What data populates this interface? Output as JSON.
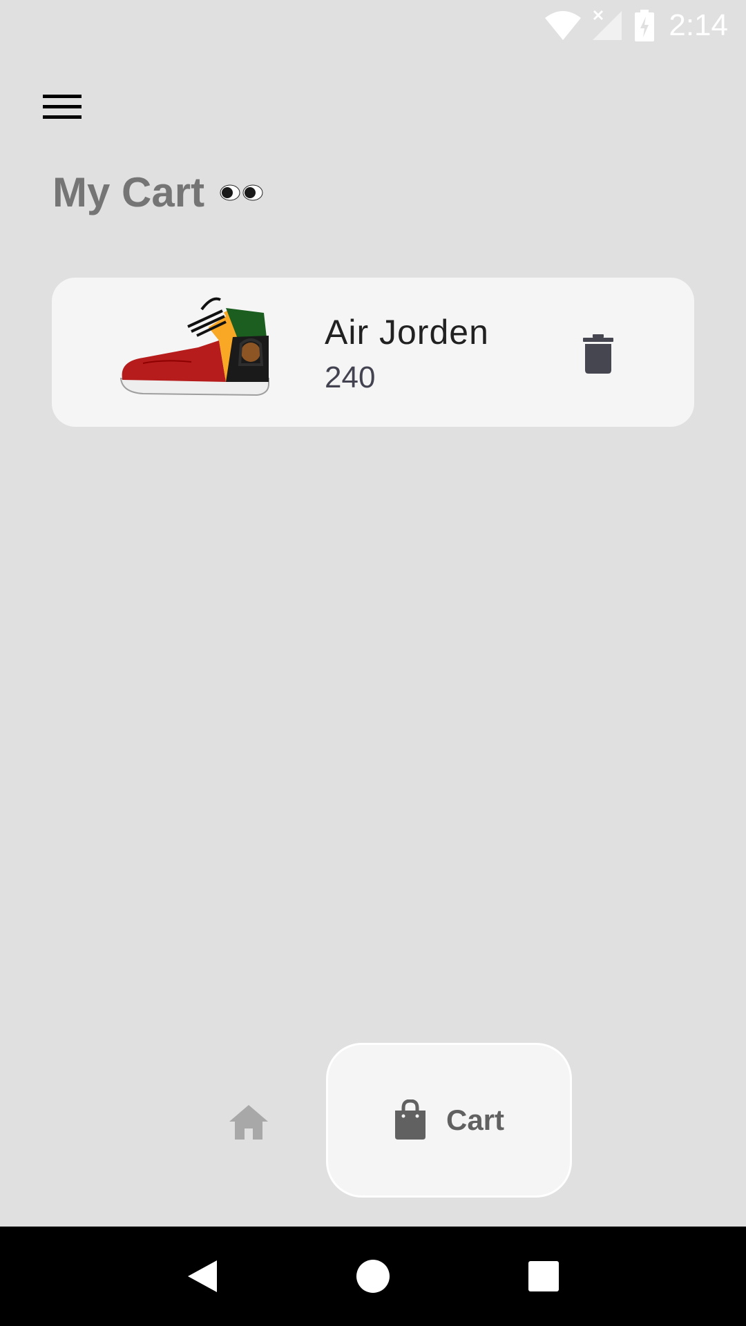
{
  "status_bar": {
    "time": "2:14",
    "icons": [
      "wifi-icon",
      "cell-signal-off-icon",
      "battery-charging-icon"
    ]
  },
  "header": {
    "menu_icon": "hamburger-menu-icon",
    "title": "My Cart",
    "title_emoji": "eyes-icon"
  },
  "cart": {
    "items": [
      {
        "name": "Air Jorden",
        "price": "240",
        "image": "sneaker-image",
        "action_icon": "trash-icon"
      }
    ]
  },
  "bottom_nav": {
    "items": [
      {
        "icon": "home-icon",
        "label": "",
        "active": false
      },
      {
        "icon": "shopping-bag-icon",
        "label": "Cart",
        "active": true
      }
    ]
  },
  "system_nav": {
    "buttons": [
      "back-icon",
      "home-circle-icon",
      "recents-square-icon"
    ]
  },
  "colors": {
    "background": "#e0e0e0",
    "card": "#f5f5f5",
    "title": "#757575",
    "nav_active": "#616161",
    "nav_inactive": "#a8a8a8"
  }
}
